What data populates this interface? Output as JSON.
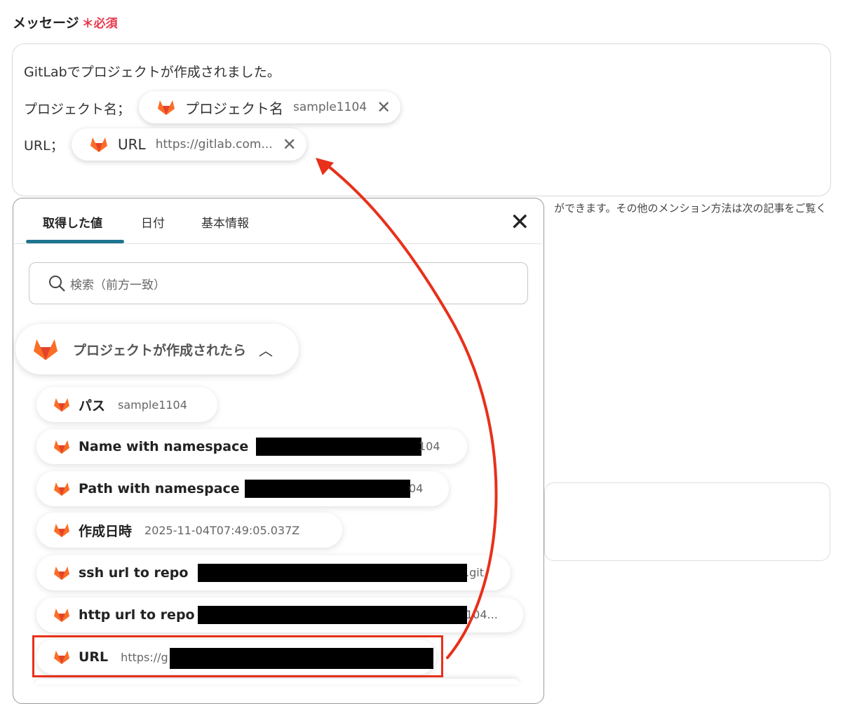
{
  "field": {
    "label": "メッセージ",
    "required_mark": "＊必須"
  },
  "message": {
    "line1": "GitLabでプロジェクトが作成されました。",
    "line2_prefix": "プロジェクト名；",
    "line3_prefix": "URL；",
    "chip_project": {
      "name": "プロジェクト名",
      "value": "sample1104"
    },
    "chip_url": {
      "name": "URL",
      "value": "https://gitlab.com..."
    }
  },
  "hint_text": "ができます。その他のメンション方法は次の記事をご覧く",
  "panel": {
    "tabs": [
      {
        "label": "取得した値"
      },
      {
        "label": "日付"
      },
      {
        "label": "基本情報"
      }
    ],
    "search_placeholder": "検索（前方一致）",
    "section_title": "プロジェクトが作成されたら",
    "items": [
      {
        "name": "パス",
        "value": "sample1104"
      },
      {
        "name": "Name with namespace",
        "value": "104"
      },
      {
        "name": "Path with namespace",
        "value": "04"
      },
      {
        "name": "作成日時",
        "value": "2025-11-04T07:49:05.037Z"
      },
      {
        "name": "ssh url to repo",
        "value": ".git"
      },
      {
        "name": "http url to repo",
        "value": "104..."
      },
      {
        "name": "URL",
        "value": "https://g"
      }
    ]
  },
  "colors": {
    "accent": "#1f7490",
    "highlight": "#e8301a",
    "required": "#e8394d"
  }
}
